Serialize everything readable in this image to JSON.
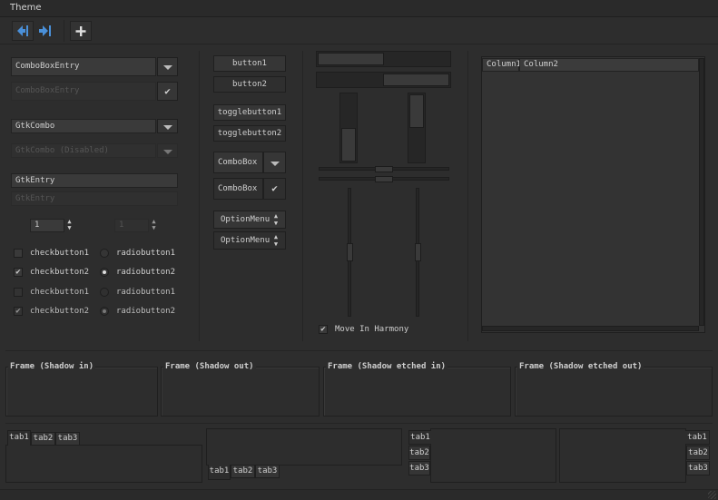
{
  "menubar": {
    "theme": "Theme"
  },
  "toolbar": {
    "back_icon": "arrow-left-icon",
    "forward_icon": "arrow-right-icon",
    "add_icon": "plus-icon"
  },
  "col1": {
    "combo_entry1": "ComboBoxEntry",
    "combo_entry2": "ComboBoxEntry",
    "gtkcombo": "GtkCombo",
    "gtkcombo_disabled": "GtkCombo (Disabled)",
    "entry1": "GtkEntry",
    "entry2": "GtkEntry",
    "spin1": "1",
    "spin2": "1",
    "check1": "checkbutton1",
    "check2": "checkbutton2",
    "check3": "checkbutton1",
    "check4": "checkbutton2",
    "radio1": "radiobutton1",
    "radio2": "radiobutton2",
    "radio3": "radiobutton1",
    "radio4": "radiobutton2"
  },
  "col2": {
    "button1": "button1",
    "button2": "button2",
    "toggle1": "togglebutton1",
    "toggle2": "togglebutton2",
    "combobox1": "ComboBox",
    "combobox2": "ComboBox",
    "option1": "OptionMenu",
    "option2": "OptionMenu"
  },
  "col3": {
    "harmony": "Move In Harmony",
    "hprogress1": 0.5,
    "hprogress2": 0.5,
    "vprogress1": 0.5,
    "vprogress2": 0.5,
    "hscale_value": 0.5,
    "vscale_value": 0.5
  },
  "tree": {
    "col1": "Column1",
    "col2": "Column2"
  },
  "frames": [
    "Frame (Shadow in)",
    "Frame (Shadow out)",
    "Frame (Shadow etched in)",
    "Frame (Shadow etched out)"
  ],
  "tabs": [
    "tab1",
    "tab2",
    "tab3"
  ],
  "colors": {
    "bg": "#2d2d2d",
    "accent": "#4a90d9"
  }
}
